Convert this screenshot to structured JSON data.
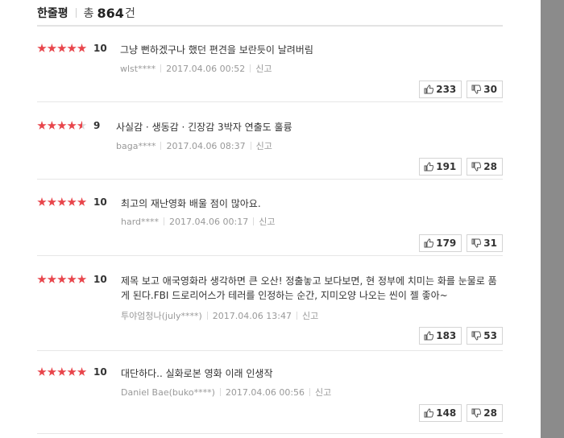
{
  "header": {
    "title": "한줄평",
    "total_prefix": "총",
    "total_count": "864",
    "total_unit": "건"
  },
  "reviews": [
    {
      "rating": 10,
      "stars": "★★★★★",
      "score": "10",
      "text": "그냥 뻔하겠구나 했던 편견을 보란듯이 날려버림",
      "user": "wlst****",
      "date": "2017.04.06 00:52",
      "report": "신고",
      "likes": "233",
      "dislikes": "30"
    },
    {
      "rating": 9,
      "stars": "★★★★½",
      "score": "9",
      "text": "사실감 · 생동감 · 긴장감 3박자 연출도 훌륭",
      "user": "baga****",
      "date": "2017.04.06 08:37",
      "report": "신고",
      "likes": "191",
      "dislikes": "28"
    },
    {
      "rating": 10,
      "stars": "★★★★★",
      "score": "10",
      "text": "최고의 재난영화 배울 점이 많아요.",
      "user": "hard****",
      "date": "2017.04.06 00:17",
      "report": "신고",
      "likes": "179",
      "dislikes": "31"
    },
    {
      "rating": 10,
      "stars": "★★★★★",
      "score": "10",
      "text": "제목 보고 애국영화라 생각하면 큰 오산! 정출놓고 보다보면, 현 정부에 치미는 화를 눈물로 품게 된다.FBI 드로리어스가 테러를 인정하는 순간, 지미오양 나오는 씬이 젤 좋아~",
      "user": "투야엄청나(july****)",
      "date": "2017.04.06 13:47",
      "report": "신고",
      "likes": "183",
      "dislikes": "53"
    },
    {
      "rating": 10,
      "stars": "★★★★★",
      "score": "10",
      "text": "대단하다.. 실화로본 영화 이래 인생작",
      "user": "Daniel Bae(buko****)",
      "date": "2017.04.06 00:56",
      "report": "신고",
      "likes": "148",
      "dislikes": "28"
    }
  ],
  "colors": {
    "star_red": "#e8454b",
    "scrollbar_gray": "#8b8b8b"
  },
  "icons": {
    "like": "thumbs-up-icon",
    "dislike": "thumbs-down-icon"
  }
}
